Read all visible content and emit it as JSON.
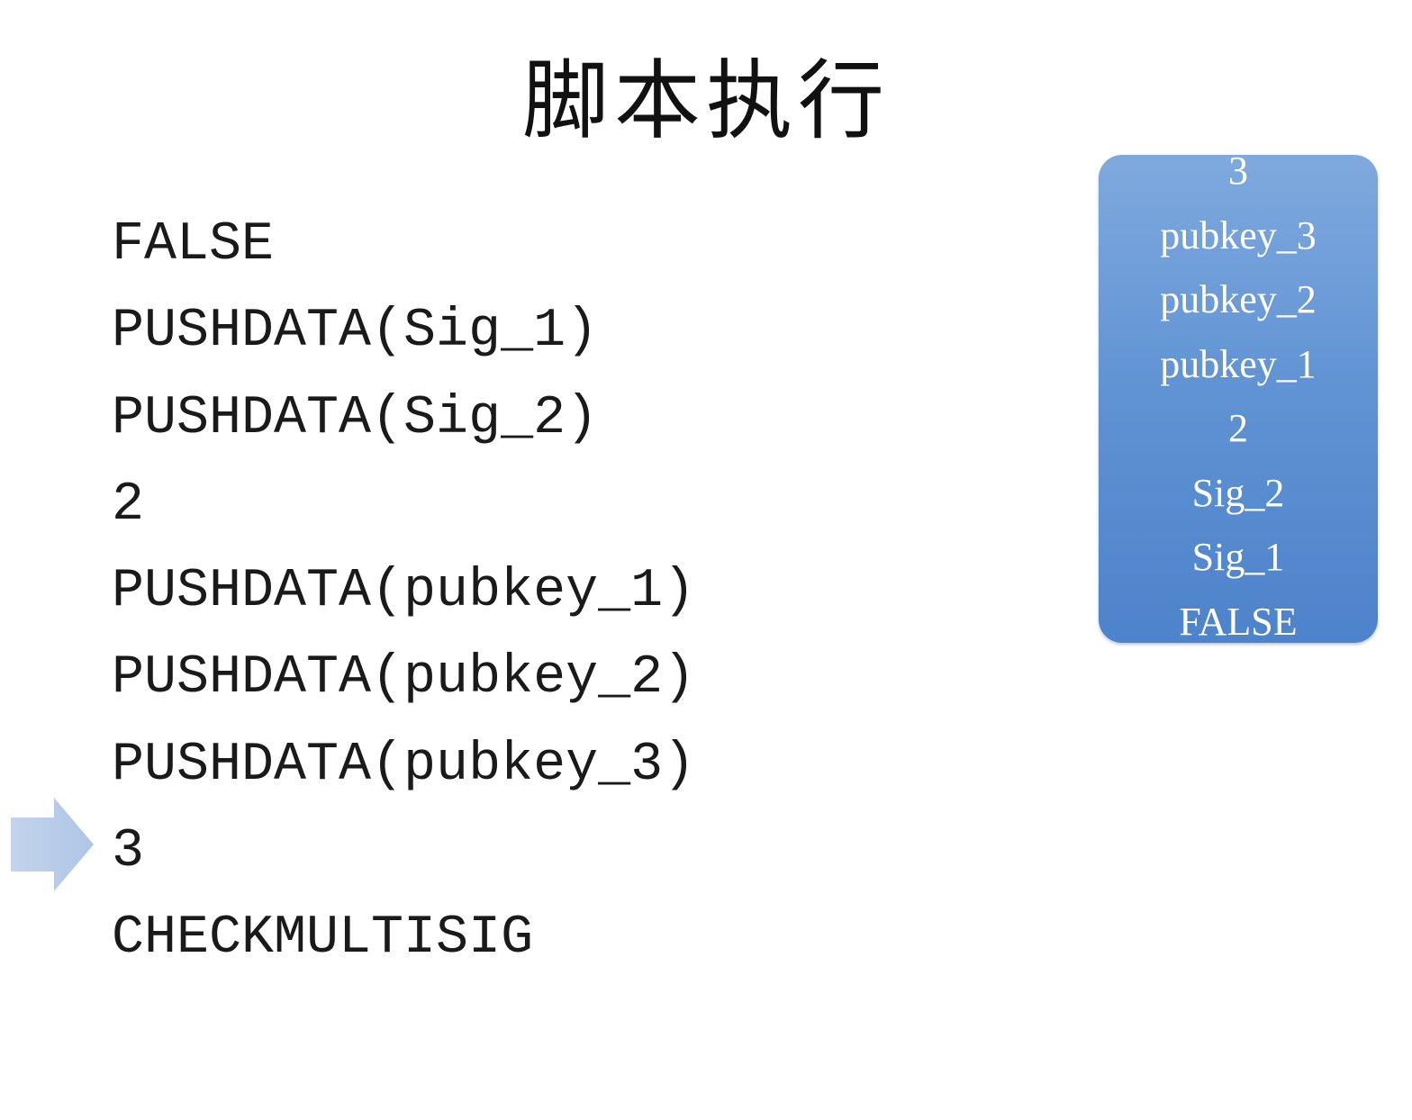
{
  "title": "脚本执行",
  "script": [
    "FALSE",
    "PUSHDATA(Sig_1)",
    "PUSHDATA(Sig_2)",
    "2",
    "PUSHDATA(pubkey_1)",
    "PUSHDATA(pubkey_2)",
    "PUSHDATA(pubkey_3)",
    "3",
    "CHECKMULTISIG"
  ],
  "current_step": 8,
  "stack": [
    "3",
    "pubkey_3",
    "pubkey_2",
    "pubkey_1",
    "2",
    "Sig_2",
    "Sig_1",
    "FALSE"
  ],
  "colors": {
    "arrow": "#b9cdea",
    "stack_top": "#7fa9de",
    "stack_bottom": "#4d83cb"
  }
}
